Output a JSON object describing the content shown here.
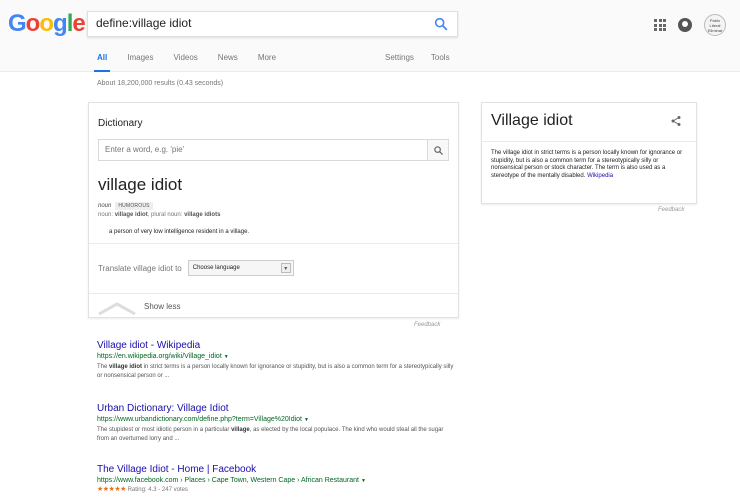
{
  "logo": {
    "letters": [
      "G",
      "o",
      "o",
      "g",
      "l",
      "e"
    ],
    "colors": [
      "#4285F4",
      "#EA4335",
      "#FBBC05",
      "#4285F4",
      "#34A853",
      "#EA4335"
    ]
  },
  "search": {
    "query": "define:village idiot"
  },
  "avatar_text": "Pablo Literal Eliminat",
  "tabs": {
    "left": [
      "All",
      "Images",
      "Videos",
      "News",
      "More"
    ],
    "right": [
      "Settings",
      "Tools"
    ]
  },
  "stats": "About 18,200,000 results (0.43 seconds)",
  "dictionary": {
    "title": "Dictionary",
    "search_placeholder": "Enter a word, e.g. 'pie'",
    "word": "village idiot",
    "pos": "noun",
    "badge": "HUMOROUS",
    "forms_label": "noun:",
    "form1": "village idiot",
    "forms_sep": ", plural noun:",
    "form2": "village idiots",
    "definition": "a person of very low intelligence resident in a village.",
    "translate_label": "Translate village idiot to",
    "language_select": "Choose language",
    "show_less": "Show less",
    "feedback": "Feedback"
  },
  "knowledge_panel": {
    "title": "Village idiot",
    "description": "The village idiot in strict terms is a person locally known for ignorance or stupidity, but is also a common term for a stereotypically silly or nonsensical person or stock character. The term is also used as a stereotype of the mentally disabled.",
    "source": "Wikipedia",
    "feedback": "Feedback"
  },
  "results": [
    {
      "title": "Village idiot - Wikipedia",
      "url": "https://en.wikipedia.org/wiki/Village_idiot",
      "snippet_pre": "The ",
      "snippet_bold": "village idiot",
      "snippet_post": " in strict terms is a person locally known for ignorance or stupidity, but is also a common term for a stereotypically silly or nonsensical person or ..."
    },
    {
      "title": "Urban Dictionary: Village Idiot",
      "url": "https://www.urbandictionary.com/define.php?term=Village%20Idiot",
      "snippet_pre": "The stupidest or most idiotic person in a particular ",
      "snippet_bold": "village",
      "snippet_post": ", as elected by the local populace. The kind who would steal all the sugar from an overturned lorry and ..."
    },
    {
      "title": "The Village Idiot - Home | Facebook",
      "url": "https://www.facebook.com › Places › Cape Town, Western Cape › African Restaurant",
      "stars": "★★★★★",
      "rating": "Rating: 4.3 - 247 votes"
    }
  ]
}
